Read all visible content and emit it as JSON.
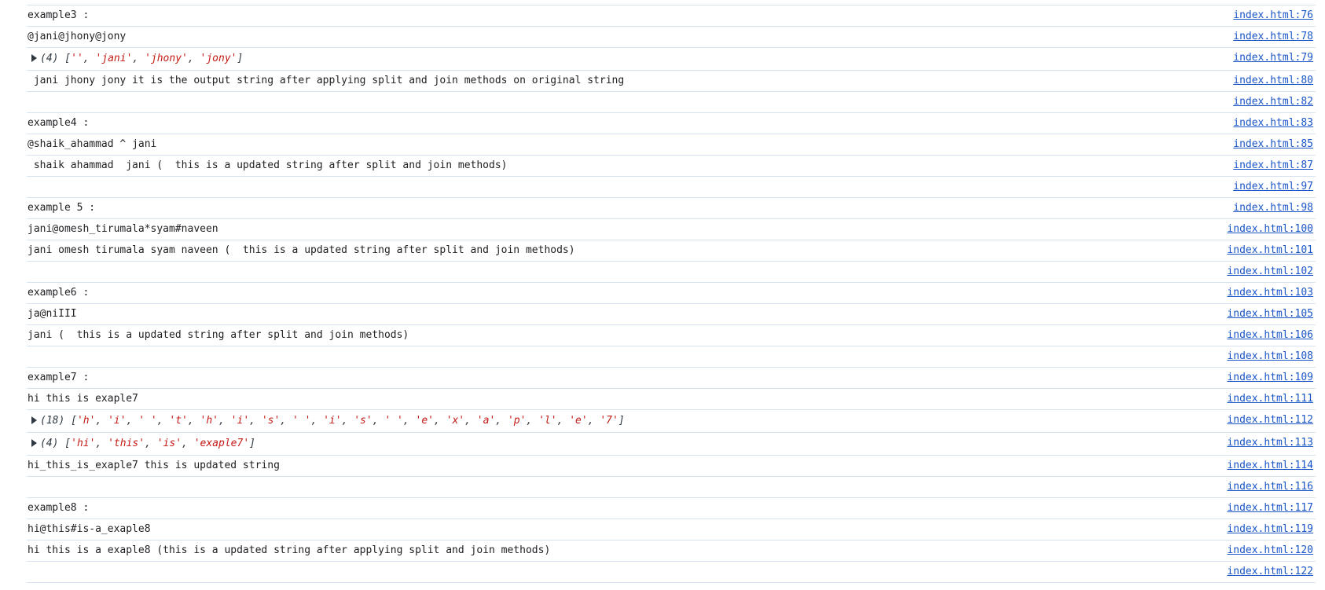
{
  "rows": [
    {
      "kind": "text",
      "text": "example3 :",
      "src": "index.html:76"
    },
    {
      "kind": "text",
      "text": "@jani@jhony@jony",
      "src": "index.html:78"
    },
    {
      "kind": "array",
      "count": "(4)",
      "items": [
        "''",
        "'jani'",
        "'jhony'",
        "'jony'"
      ],
      "src": "index.html:79"
    },
    {
      "kind": "text",
      "text": " jani jhony jony it is the output string after applying split and join methods on original string",
      "src": "index.html:80"
    },
    {
      "kind": "text",
      "text": "",
      "src": "index.html:82"
    },
    {
      "kind": "text",
      "text": "example4 :",
      "src": "index.html:83"
    },
    {
      "kind": "text",
      "text": "@shaik_ahammad ^ jani",
      "src": "index.html:85"
    },
    {
      "kind": "text",
      "text": " shaik ahammad  jani (  this is a updated string after split and join methods)",
      "src": "index.html:87"
    },
    {
      "kind": "text",
      "text": "",
      "src": "index.html:97"
    },
    {
      "kind": "text",
      "text": "example 5 :",
      "src": "index.html:98"
    },
    {
      "kind": "text",
      "text": "jani@omesh_tirumala*syam#naveen",
      "src": "index.html:100"
    },
    {
      "kind": "text",
      "text": "jani omesh tirumala syam naveen (  this is a updated string after split and join methods)",
      "src": "index.html:101"
    },
    {
      "kind": "text",
      "text": "",
      "src": "index.html:102"
    },
    {
      "kind": "text",
      "text": "example6 :",
      "src": "index.html:103"
    },
    {
      "kind": "text",
      "text": "ja@niIII",
      "src": "index.html:105"
    },
    {
      "kind": "text",
      "text": "jani (  this is a updated string after split and join methods)",
      "src": "index.html:106"
    },
    {
      "kind": "text",
      "text": "",
      "src": "index.html:108"
    },
    {
      "kind": "text",
      "text": "example7 :",
      "src": "index.html:109"
    },
    {
      "kind": "text",
      "text": "hi this is exaple7",
      "src": "index.html:111"
    },
    {
      "kind": "array",
      "count": "(18)",
      "items": [
        "'h'",
        "'i'",
        "' '",
        "'t'",
        "'h'",
        "'i'",
        "'s'",
        "' '",
        "'i'",
        "'s'",
        "' '",
        "'e'",
        "'x'",
        "'a'",
        "'p'",
        "'l'",
        "'e'",
        "'7'"
      ],
      "src": "index.html:112"
    },
    {
      "kind": "array",
      "count": "(4)",
      "items": [
        "'hi'",
        "'this'",
        "'is'",
        "'exaple7'"
      ],
      "src": "index.html:113"
    },
    {
      "kind": "text",
      "text": "hi_this_is_exaple7 this is updated string",
      "src": "index.html:114"
    },
    {
      "kind": "text",
      "text": "",
      "src": "index.html:116"
    },
    {
      "kind": "text",
      "text": "example8 :",
      "src": "index.html:117"
    },
    {
      "kind": "text",
      "text": "hi@this#is-a_exaple8",
      "src": "index.html:119"
    },
    {
      "kind": "text",
      "text": "hi this is a exaple8 (this is a updated string after applying split and join methods)",
      "src": "index.html:120"
    },
    {
      "kind": "text",
      "text": "",
      "src": "index.html:122"
    }
  ]
}
